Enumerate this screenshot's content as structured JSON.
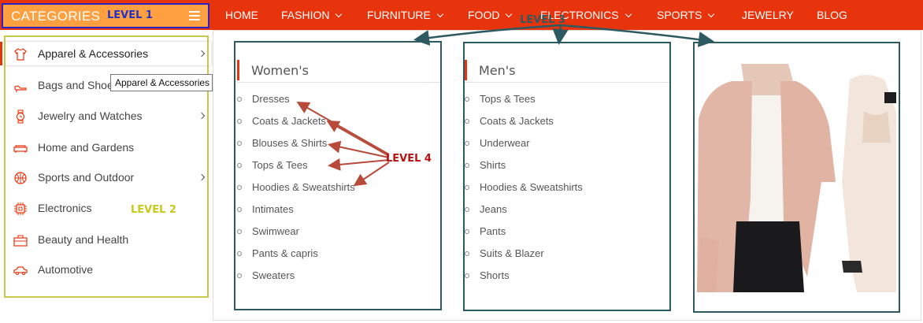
{
  "header": {
    "categories_label": "CATEGORIES",
    "level1_annotation": "LEVEL 1",
    "menu_icon": "hamburger-icon",
    "accent_color": "#e8340c",
    "categories_bg_color": "#ffa040"
  },
  "nav": {
    "items": [
      {
        "label": "HOME",
        "dropdown": false
      },
      {
        "label": "FASHION",
        "dropdown": true
      },
      {
        "label": "FURNITURE",
        "dropdown": true
      },
      {
        "label": "FOOD",
        "dropdown": true
      },
      {
        "label": "ELECTRONICS",
        "dropdown": true
      },
      {
        "label": "SPORTS",
        "dropdown": true
      },
      {
        "label": "JEWELRY",
        "dropdown": false
      },
      {
        "label": "BLOG",
        "dropdown": false
      }
    ]
  },
  "sidebar": {
    "level2_annotation": "LEVEL 2",
    "tooltip": "Apparel & Accessories",
    "items": [
      {
        "label": "Apparel & Accessories",
        "icon": "shirt-icon",
        "has_submenu": true,
        "active": true
      },
      {
        "label": "Bags and Shoes",
        "icon": "shoe-icon",
        "has_submenu": false,
        "active": false
      },
      {
        "label": "Jewelry and Watches",
        "icon": "watch-icon",
        "has_submenu": true,
        "active": false
      },
      {
        "label": "Home and Gardens",
        "icon": "sofa-icon",
        "has_submenu": false,
        "active": false
      },
      {
        "label": "Sports and Outdoor",
        "icon": "basketball-icon",
        "has_submenu": true,
        "active": false
      },
      {
        "label": "Electronics",
        "icon": "chip-icon",
        "has_submenu": false,
        "active": false
      },
      {
        "label": "Beauty and Health",
        "icon": "briefcase-icon",
        "has_submenu": false,
        "active": false
      },
      {
        "label": "Automotive",
        "icon": "car-icon",
        "has_submenu": false,
        "active": false
      }
    ]
  },
  "mega_menu": {
    "level3_annotation": "LEVEL 3",
    "level4_annotation": "LEVEL 4",
    "womens": {
      "title": "Women's",
      "items": [
        "Dresses",
        "Coats & Jackets",
        "Blouses & Shirts",
        "Tops & Tees",
        "Hoodies & Sweatshirts",
        "Intimates",
        "Swimwear",
        "Pants & capris",
        "Sweaters"
      ]
    },
    "mens": {
      "title": "Men's",
      "items": [
        "Tops & Tees",
        "Coats & Jackets",
        "Underwear",
        "Shirts",
        "Hoodies & Sweatshirts",
        "Jeans",
        "Pants",
        "Suits & Blazer",
        "Shorts"
      ]
    },
    "promo_image": "fashion-models-photo"
  }
}
